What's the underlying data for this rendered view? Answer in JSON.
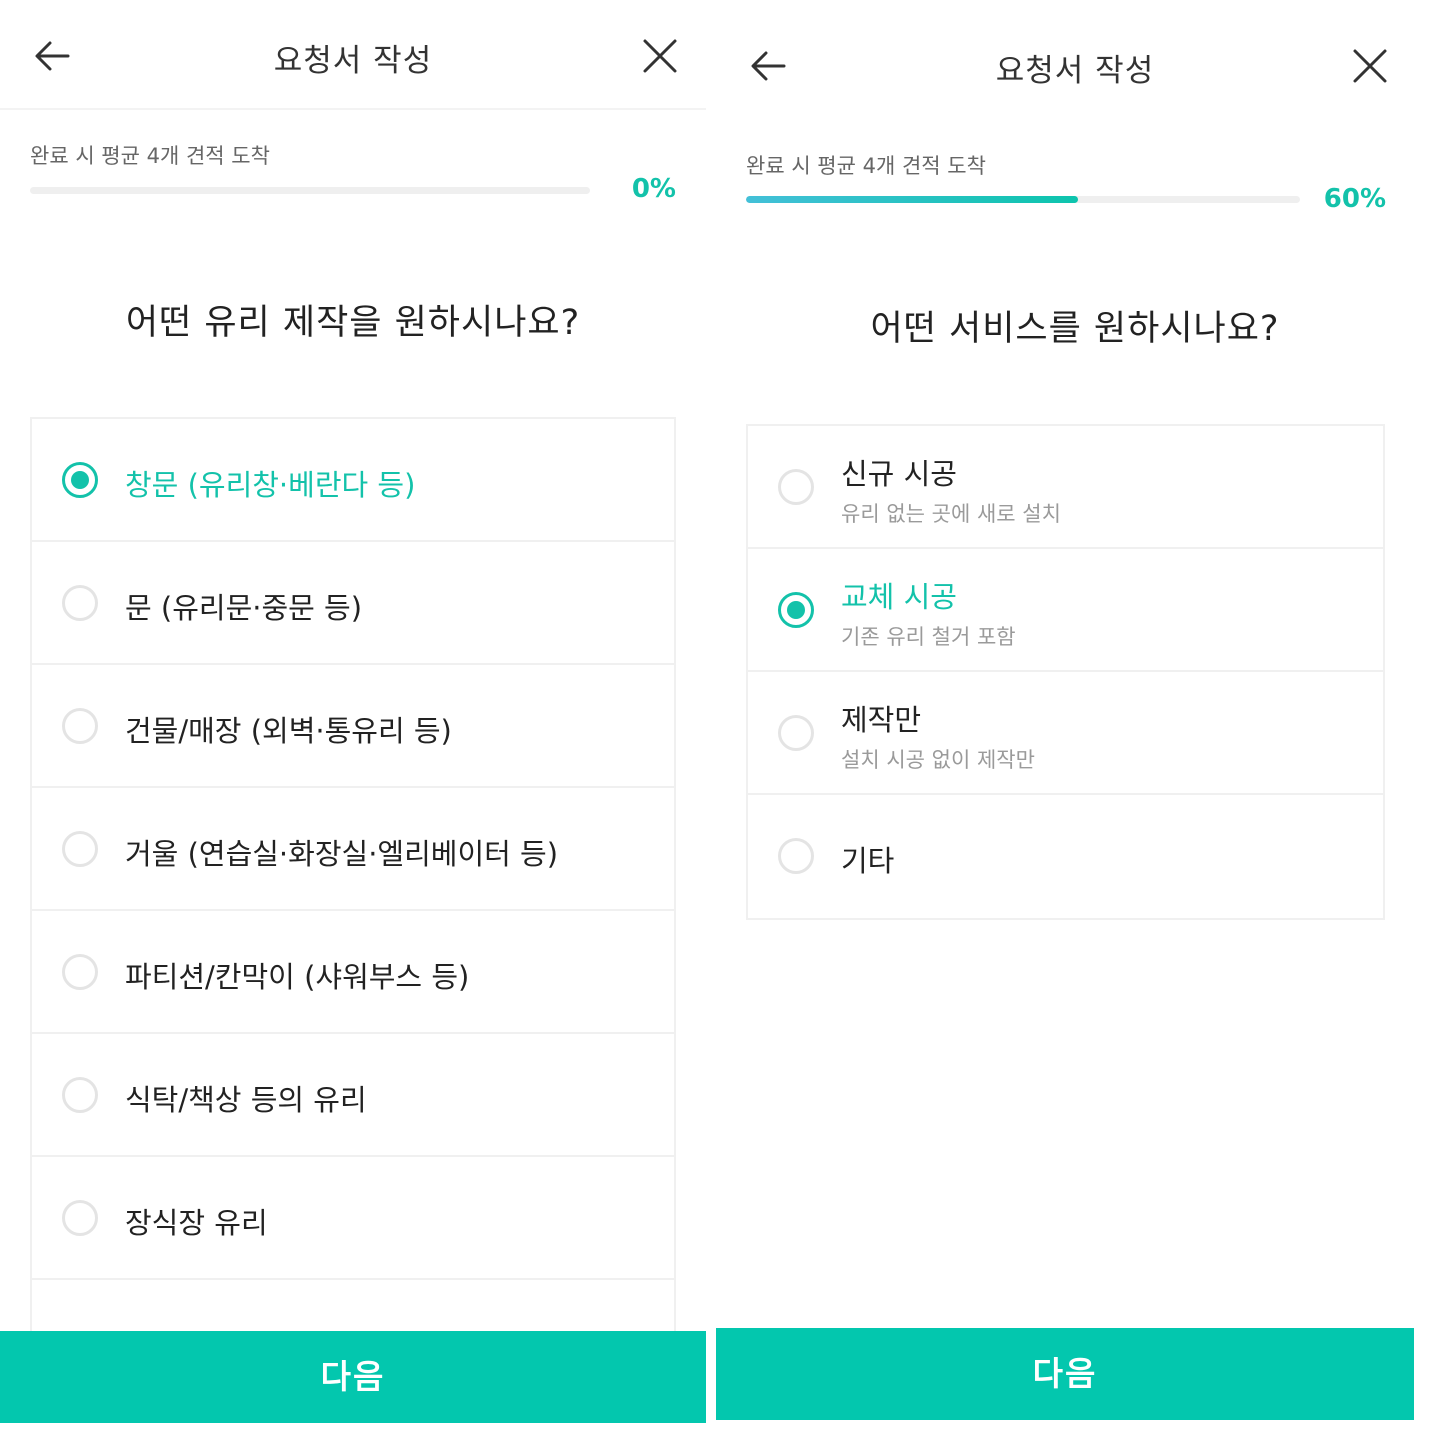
{
  "left": {
    "header": {
      "title": "요청서 작성"
    },
    "progress": {
      "hint": "완료 시 평균 4개 견적 도착",
      "percent_label": "0%",
      "value": 0
    },
    "question": "어떤 유리 제작을 원하시나요?",
    "options": [
      {
        "label": "창문 (유리창·베란다 등)",
        "selected": true
      },
      {
        "label": "문 (유리문·중문 등)",
        "selected": false
      },
      {
        "label": "건물/매장 (외벽·통유리 등)",
        "selected": false
      },
      {
        "label": "거울 (연습실·화장실·엘리베이터 등)",
        "selected": false
      },
      {
        "label": "파티션/칸막이 (샤워부스 등)",
        "selected": false
      },
      {
        "label": "식탁/책상 등의 유리",
        "selected": false
      },
      {
        "label": "장식장 유리",
        "selected": false
      }
    ],
    "next_label": "다음"
  },
  "right": {
    "header": {
      "title": "요청서 작성"
    },
    "progress": {
      "hint": "완료 시 평균 4개 견적 도착",
      "percent_label": "60%",
      "value": 0.6
    },
    "question": "어떤 서비스를 원하시나요?",
    "options": [
      {
        "label": "신규 시공",
        "sub": "유리 없는 곳에 새로 설치",
        "selected": false
      },
      {
        "label": "교체 시공",
        "sub": "기존 유리 철거 포함",
        "selected": true
      },
      {
        "label": "제작만",
        "sub": "설치 시공 없이 제작만",
        "selected": false
      },
      {
        "label": "기타",
        "selected": false
      }
    ],
    "next_label": "다음"
  },
  "colors": {
    "accent": "#13c2aa",
    "button": "#03c7ae"
  },
  "icons": {
    "back": "arrow-left-icon",
    "close": "close-icon"
  }
}
